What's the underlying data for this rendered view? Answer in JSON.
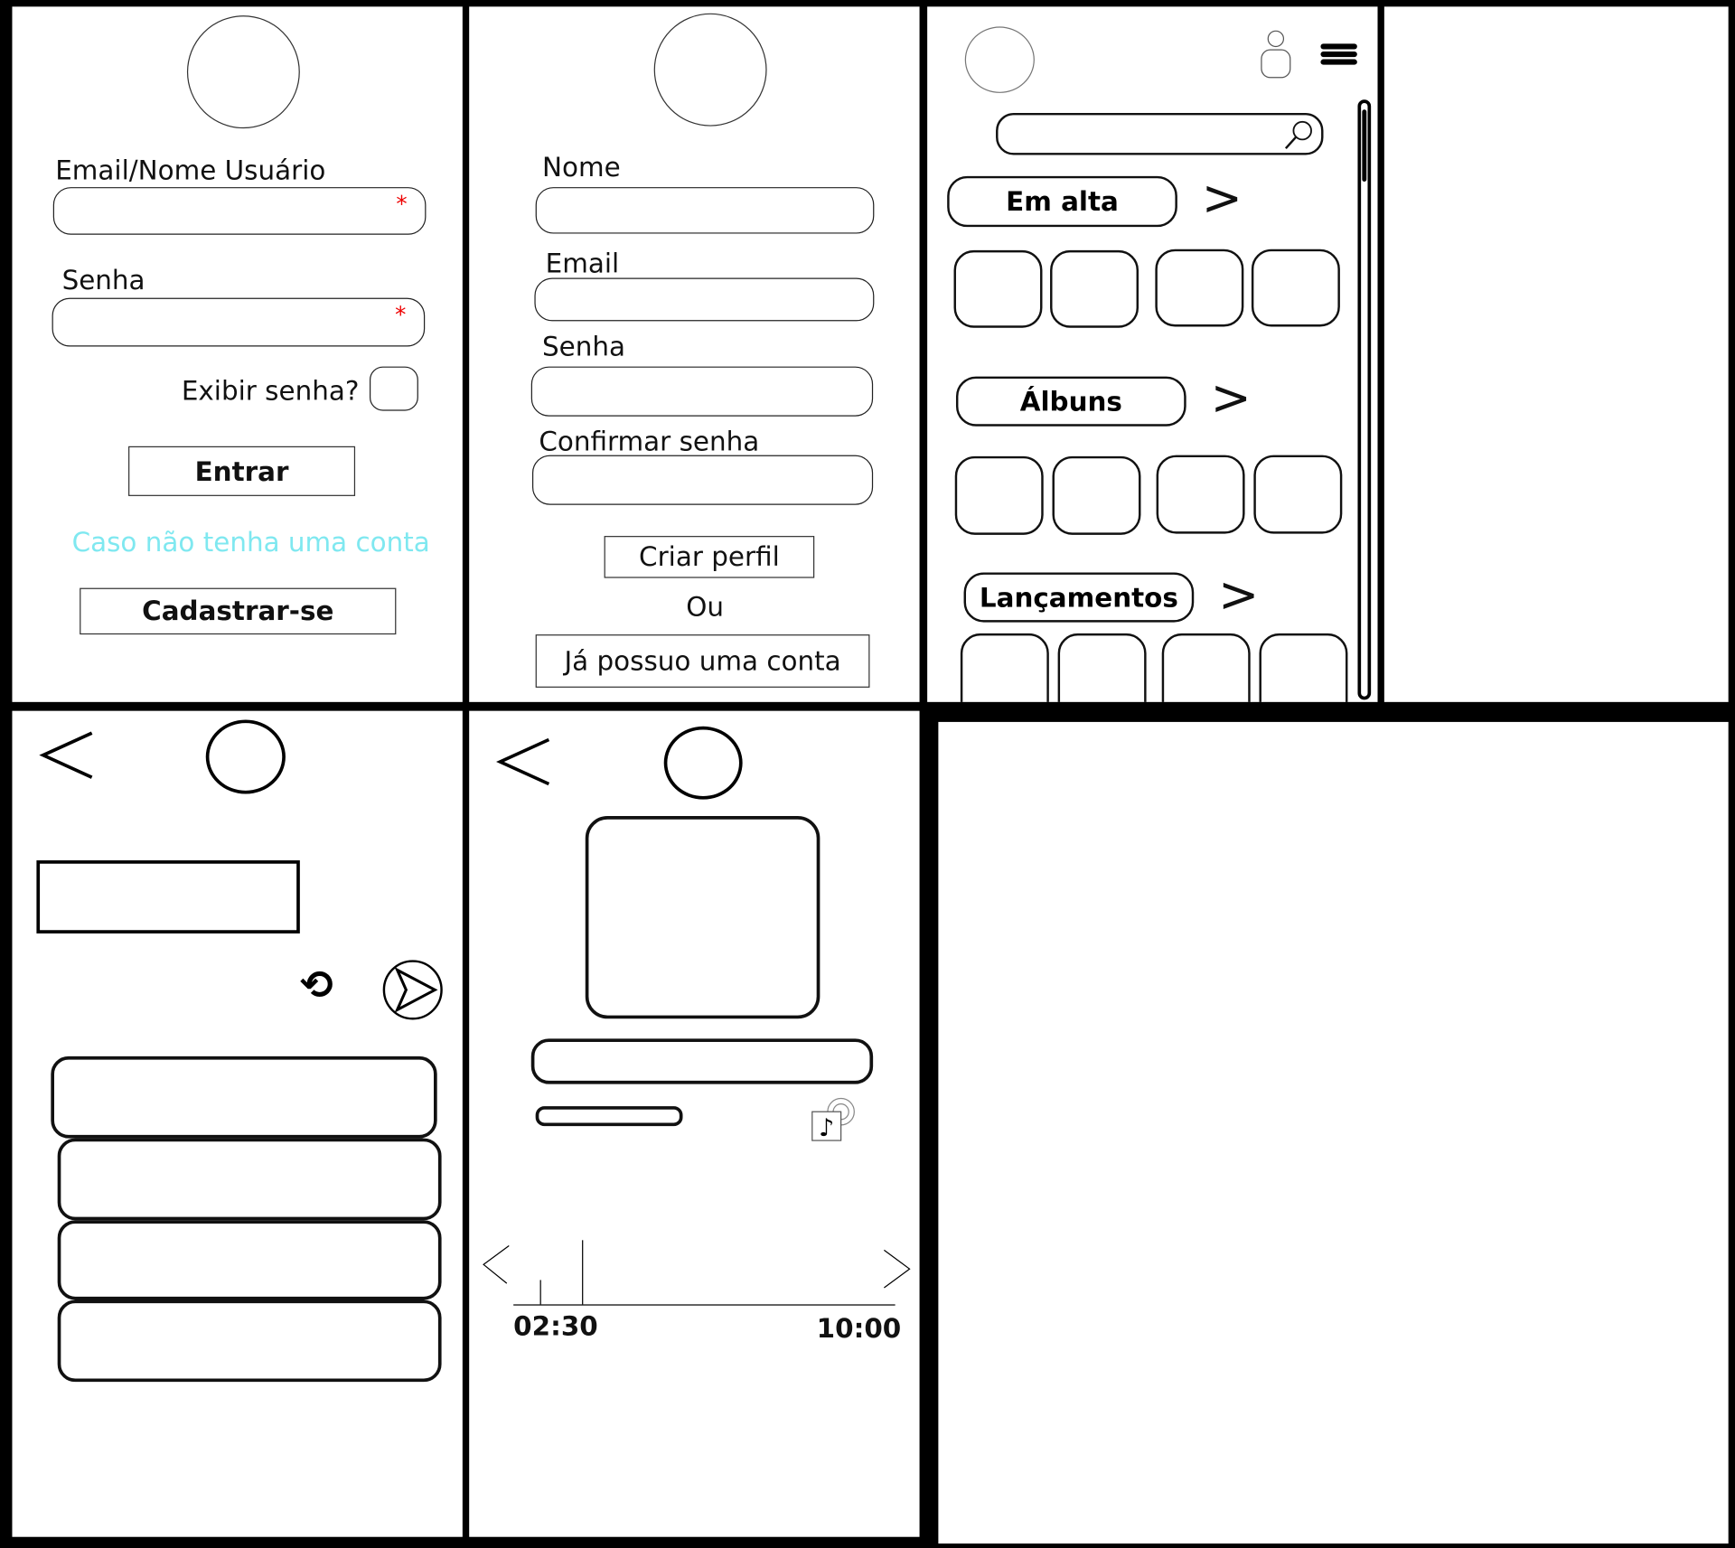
{
  "login": {
    "email_label": "Email/Nome Usuário",
    "password_label": "Senha",
    "required_mark": "*",
    "show_password_label": "Exibir senha?",
    "show_password_checked": false,
    "enter_button": "Entrar",
    "no_account_text": "Caso não tenha uma conta",
    "no_account_color": "#7fe8f0",
    "signup_button": "Cadastrar-se"
  },
  "register": {
    "name_label": "Nome",
    "email_label": "Email",
    "password_label": "Senha",
    "confirm_label": "Confirmar senha",
    "create_button": "Criar perfil",
    "or_text": "Ou",
    "have_account_button": "Já possuo uma conta"
  },
  "home": {
    "icons": [
      "logo-circle",
      "user-icon",
      "menu-icon",
      "search-icon"
    ],
    "sections": [
      {
        "title": "Em alta",
        "more": ">"
      },
      {
        "title": "Álbuns",
        "more": ">"
      },
      {
        "title": "Lançamentos",
        "more": ">"
      }
    ]
  },
  "chat": {
    "back": "<",
    "icons": [
      "back-icon",
      "repeat-icon",
      "send-icon"
    ]
  },
  "player": {
    "back": "<",
    "prev": "<",
    "next": ">",
    "current_time": "02:30",
    "total_time": "10:00",
    "progress_percent": 25
  }
}
